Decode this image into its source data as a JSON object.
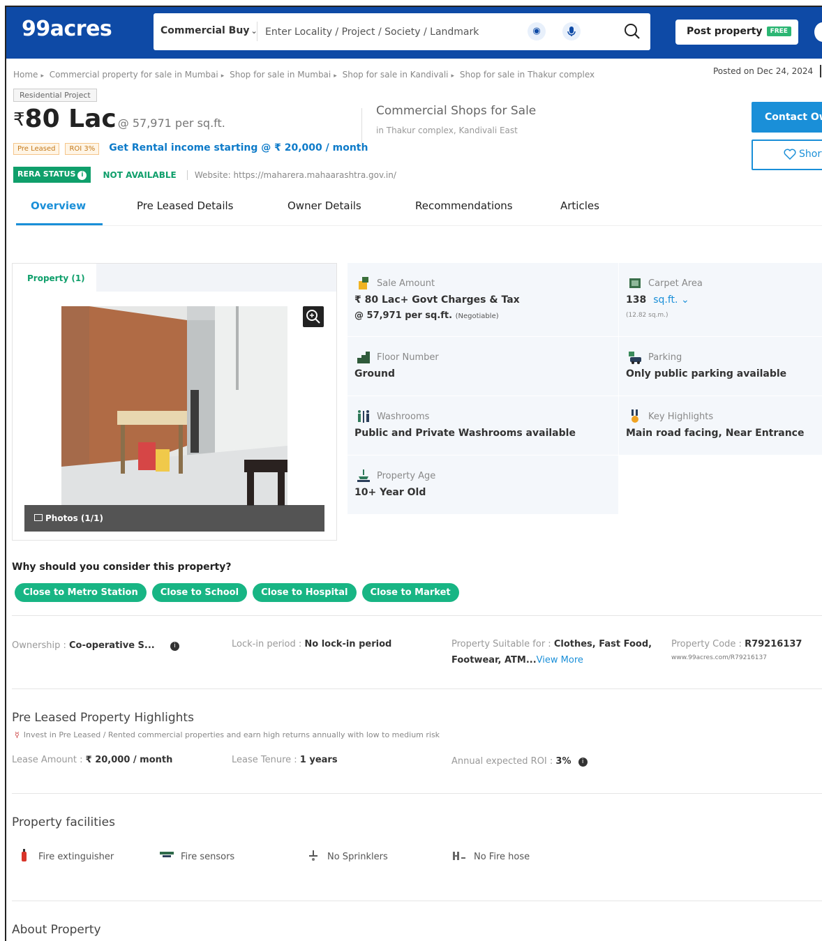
{
  "header": {
    "logo": "99acres",
    "search_type": "Commercial Buy",
    "search_placeholder": "Enter Locality / Project / Society / Landmark",
    "post_property_label": "Post property",
    "free_badge": "FREE"
  },
  "breadcrumb": [
    "Home",
    "Commercial property for sale in Mumbai",
    "Shop for sale in Mumbai",
    "Shop for sale in Kandivali",
    "Shop for sale in Thakur complex"
  ],
  "posted_on": "Posted on Dec 24, 2024",
  "listing": {
    "project_tag": "Residential Project",
    "currency": "₹",
    "price": "80 Lac",
    "price_per_sqft": "@ 57,971 per sq.ft.",
    "tag_pre_leased": "Pre Leased",
    "tag_roi": "ROI 3%",
    "rental_income": "Get Rental income starting @ ₹ 20,000 / month",
    "title": "Commercial Shops for Sale",
    "location": "in Thakur complex, Kandivali East",
    "contact_label": "Contact Owner",
    "shortlist_label": "Shortlist",
    "rera_status": "RERA STATUS",
    "rera_value": "NOT AVAILABLE",
    "rera_website": "Website: https://maharera.mahaarashtra.gov.in/"
  },
  "tabs": [
    {
      "label": "Overview",
      "active": true
    },
    {
      "label": "Pre Leased Details",
      "active": false
    },
    {
      "label": "Owner Details",
      "active": false
    },
    {
      "label": "Recommendations",
      "active": false
    },
    {
      "label": "Articles",
      "active": false
    }
  ],
  "gallery": {
    "tab_label": "Property (1)",
    "photos_label": "Photos (1/1)"
  },
  "details": {
    "sale_amount": {
      "label": "Sale Amount",
      "value": "₹ 80 Lac+ Govt Charges & Tax",
      "per_sqft": "@ 57,971 per sq.ft.",
      "negotiable": "(Negotiable)"
    },
    "carpet_area": {
      "label": "Carpet Area",
      "value": "138",
      "unit": "sq.ft.",
      "sqm": "(12.82 sq.m.)"
    },
    "floor_number": {
      "label": "Floor Number",
      "value": "Ground"
    },
    "parking": {
      "label": "Parking",
      "value": "Only public parking available"
    },
    "washrooms": {
      "label": "Washrooms",
      "value": "Public and Private Washrooms available"
    },
    "key_highlights": {
      "label": "Key Highlights",
      "value": "Main road facing, Near Entrance"
    },
    "property_age": {
      "label": "Property Age",
      "value": "10+ Year Old"
    }
  },
  "why_consider": {
    "title": "Why should you consider this property?",
    "pills": [
      "Close to Metro Station",
      "Close to School",
      "Close to Hospital",
      "Close to Market"
    ]
  },
  "attributes": {
    "ownership_label": "Ownership : ",
    "ownership_value": "Co-operative S...",
    "lockin_label": "Lock-in period : ",
    "lockin_value": "No lock-in period",
    "suitable_label": "Property Suitable for : ",
    "suitable_value_1": "Clothes, Fast Food,",
    "suitable_value_2": "Footwear, ATM...",
    "view_more": "View More",
    "code_label": "Property Code : ",
    "code_value": "R79216137",
    "code_url": "www.99acres.com/R79216137"
  },
  "pre_leased": {
    "title": "Pre Leased Property Highlights",
    "note": "Invest in Pre Leased / Rented commercial properties and earn high returns annually with low to medium risk",
    "lease_amount_label": "Lease Amount : ",
    "lease_amount_value": "₹ 20,000 / month",
    "lease_tenure_label": "Lease Tenure : ",
    "lease_tenure_value": "1 years",
    "roi_label": "Annual expected ROI : ",
    "roi_value": "3%"
  },
  "facilities": {
    "title": "Property facilities",
    "items": [
      "Fire extinguisher",
      "Fire sensors",
      "No Sprinklers",
      "No Fire hose"
    ]
  },
  "about": {
    "title": "About Property"
  }
}
